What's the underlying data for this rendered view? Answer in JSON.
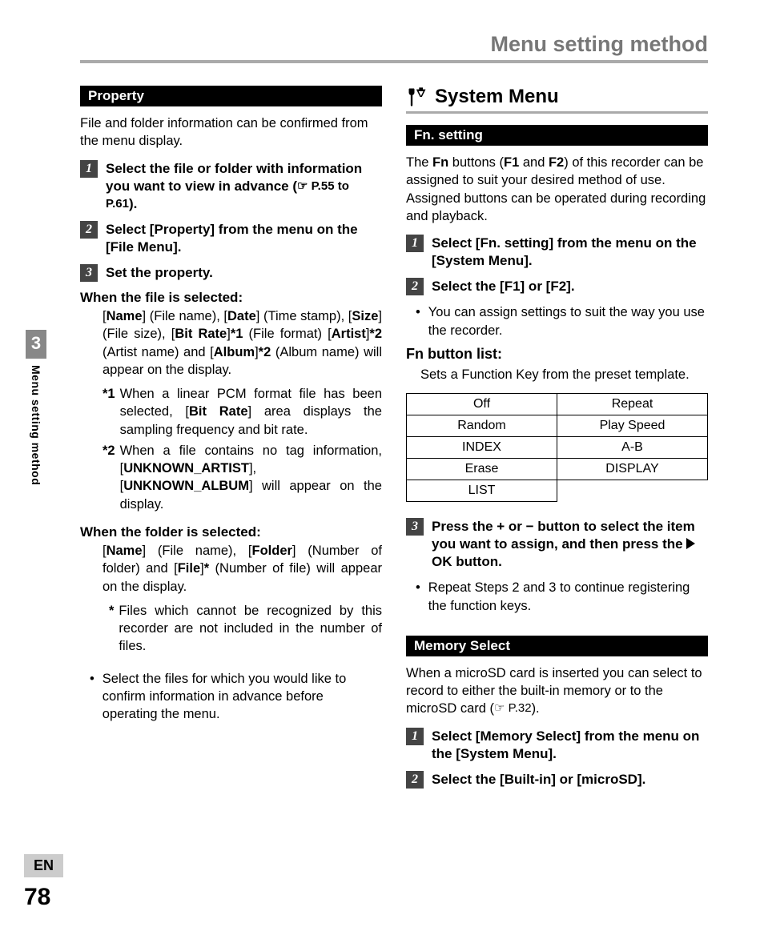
{
  "header": {
    "title": "Menu setting method"
  },
  "sidebar": {
    "chapter": "3",
    "label": "Menu setting method"
  },
  "footer": {
    "lang": "EN",
    "page": "78"
  },
  "left": {
    "property_bar": "Property",
    "intro": "File and folder information can be confirmed from the menu display.",
    "step1_a": "Select the file or folder with information you want to view in advance (",
    "step1_ref": "☞ P.55 to P.61",
    "step1_b": ").",
    "step2_a": "Select [",
    "step2_prop": "Property",
    "step2_b": "] from the menu on the [",
    "step2_menu": "File Menu",
    "step2_c": "].",
    "step3": "Set the property.",
    "file_heading": "When the file is selected:",
    "file_body_parts": {
      "name": "Name",
      "name_note": " (File name), ",
      "date": "Date",
      "date_note": " (Time stamp), ",
      "size": "Size",
      "size_note": " (File size), ",
      "bitrate": "Bit Rate",
      "star1": "*1",
      "bitrate_note": " (File format) ",
      "artist": "Artist",
      "star2": "*2",
      "artist_note": " (Artist name) and ",
      "album": "Album",
      "album_note": " (Album name) will appear on the display."
    },
    "fn1_mark": "*1",
    "fn1_a": "When a linear PCM format file has been selected, [",
    "fn1_bitrate": "Bit Rate",
    "fn1_b": "] area displays the sampling frequency and bit rate.",
    "fn2_mark": "*2",
    "fn2_a": "When a file contains no tag information, [",
    "fn2_ua": "UNKNOWN_ARTIST",
    "fn2_b": "], [",
    "fn2_ub": "UNKNOWN_ALBUM",
    "fn2_c": "] will appear on the display.",
    "folder_heading": "When the folder is selected:",
    "folder_body_parts": {
      "name": "Name",
      "name_note": " (File name), ",
      "folder": "Folder",
      "folder_note": " (Number of folder) and ",
      "file": "File",
      "star": "*",
      "file_note": " (Number of file) will appear on the display."
    },
    "fstar_mark": "*",
    "fstar_text": "Files which cannot be recognized by this recorder are not included in the number of files.",
    "bottom_bullet": "Select the files for which you would like to confirm information in advance before operating the menu."
  },
  "right": {
    "system_menu": "System Menu",
    "fnsetting_bar": "Fn. setting",
    "fn_intro_a": "The ",
    "fn_intro_fn": "Fn",
    "fn_intro_b": " buttons (",
    "fn_intro_f1": "F1",
    "fn_intro_c": " and ",
    "fn_intro_f2": "F2",
    "fn_intro_d": ") of this recorder can be assigned to suit your desired method of use. Assigned buttons can be operated during recording and playback.",
    "fn_step1_a": "Select [",
    "fn_step1_fn": "Fn. setting",
    "fn_step1_b": "] from the menu on the [",
    "fn_step1_sys": "System Menu",
    "fn_step1_c": "].",
    "fn_step2_a": "Select the [",
    "fn_step2_f1": "F1",
    "fn_step2_b": "] or [",
    "fn_step2_f2": "F2",
    "fn_step2_c": "].",
    "fn_step2_bullet": "You can assign settings to suit the way you use the recorder.",
    "fnlist_heading": "Fn button list:",
    "fnlist_desc": "Sets a Function Key from the preset template.",
    "table": [
      [
        "Off",
        "Repeat"
      ],
      [
        "Random",
        "Play Speed"
      ],
      [
        "INDEX",
        "A-B"
      ],
      [
        "Erase",
        "DISPLAY"
      ],
      [
        "LIST",
        ""
      ]
    ],
    "fn_step3_a": "Press the + or − button to select the item you want to assign, and then press the ",
    "fn_step3_ok": "OK",
    "fn_step3_b": " button.",
    "fn_step3_bullet": "Repeat Steps 2 and 3 to continue registering the function keys.",
    "memsel_bar": "Memory Select",
    "memsel_intro_a": "When a microSD card is inserted you can select to record to either the built-in memory or to the microSD card (",
    "memsel_ref": "☞ P.32",
    "memsel_intro_b": ").",
    "mem_step1_a": "Select [",
    "mem_step1_ms": "Memory Select",
    "mem_step1_b": "] from the menu on the [",
    "mem_step1_sys": "System Menu",
    "mem_step1_c": "].",
    "mem_step2_a": "Select the [",
    "mem_step2_bi": "Built-in",
    "mem_step2_b": "] or [",
    "mem_step2_sd": "microSD",
    "mem_step2_c": "]."
  }
}
